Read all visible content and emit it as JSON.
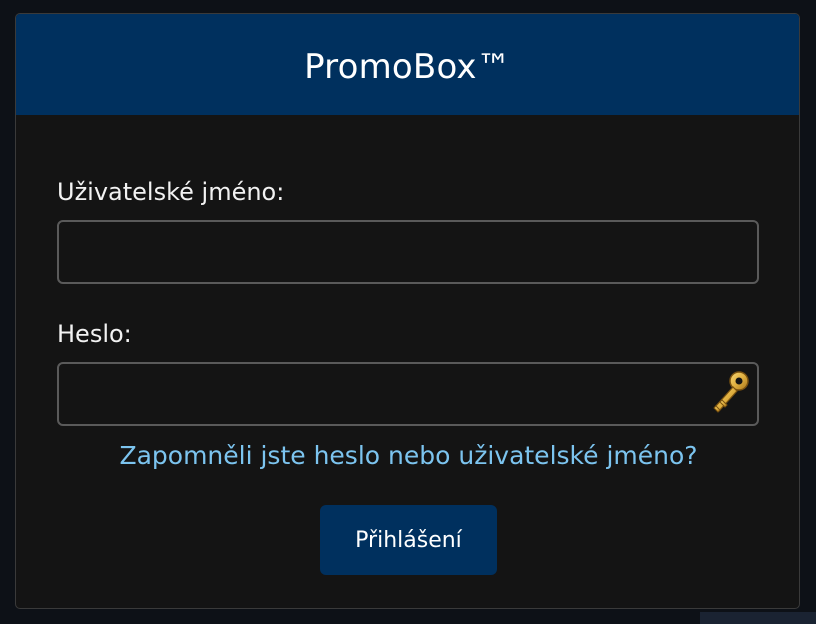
{
  "app": {
    "title": "PromoBox™"
  },
  "form": {
    "username": {
      "label": "Uživatelské jméno:",
      "value": "",
      "placeholder": ""
    },
    "password": {
      "label": "Heslo:",
      "value": "",
      "placeholder": "",
      "icon": "key-icon"
    },
    "forgot_link": "Zapomněli jste heslo nebo uživatelské jméno?",
    "submit_label": "Přihlášení"
  },
  "colors": {
    "header_bg": "#00305e",
    "card_bg": "#141414",
    "link": "#7cc4ef",
    "button_bg": "#00305e",
    "key_gold": "#e0b040"
  }
}
